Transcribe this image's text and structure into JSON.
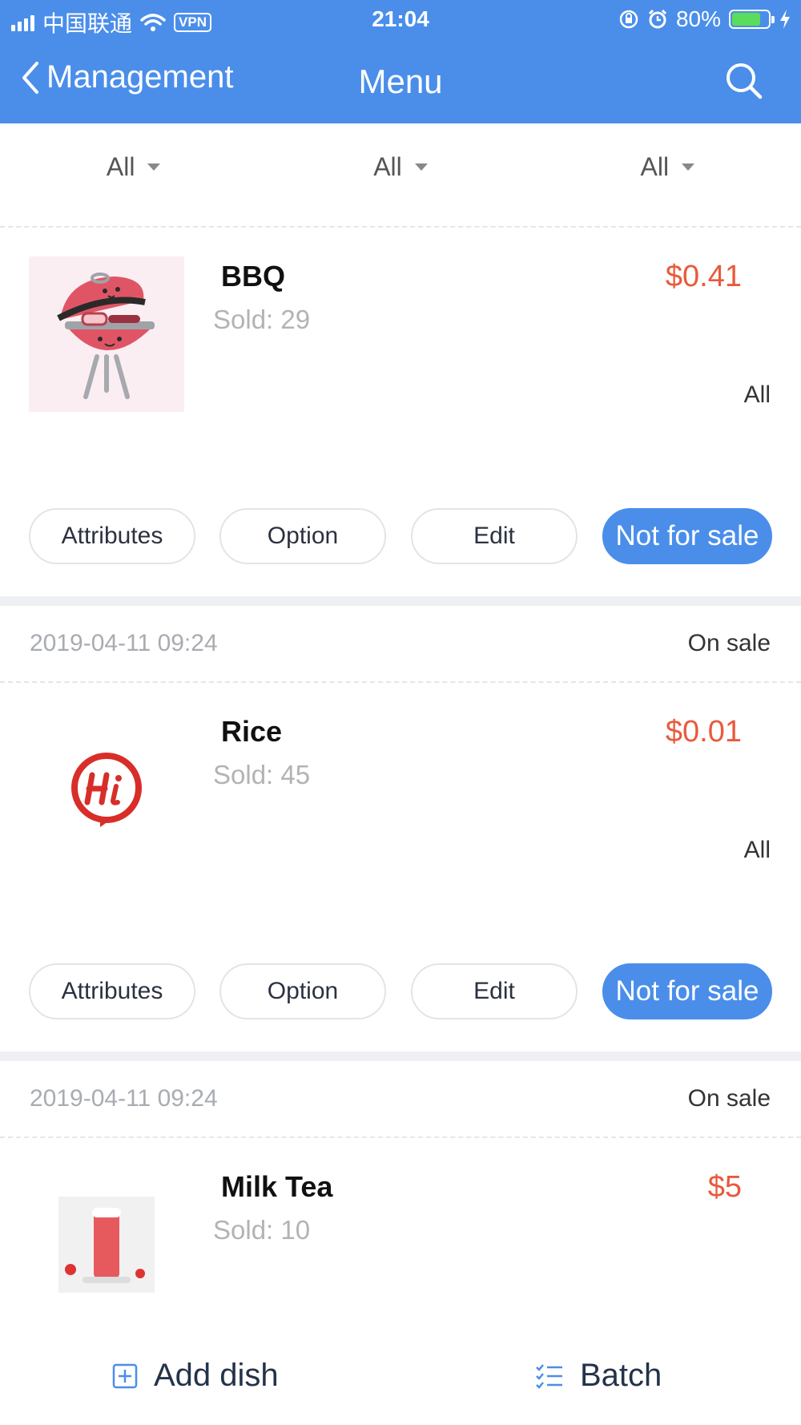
{
  "status_bar": {
    "carrier": "中国联通",
    "vpn": "VPN",
    "time": "21:04",
    "battery": "80%",
    "battery_level": 0.8
  },
  "nav": {
    "back_label": "Management",
    "title": "Menu"
  },
  "filters": [
    {
      "label": "All"
    },
    {
      "label": "All"
    },
    {
      "label": "All"
    }
  ],
  "dishes": [
    {
      "name": "BBQ",
      "sold": "Sold: 29",
      "price": "$0.41",
      "category": "All",
      "image_icon": "bbq-grill-image"
    },
    {
      "name": "Rice",
      "sold": "Sold: 45",
      "price": "$0.01",
      "category": "All",
      "image_icon": "hi-logo-image",
      "date": "2019-04-11 09:24",
      "status": "On sale"
    },
    {
      "name": "Milk Tea",
      "sold": "Sold: 10",
      "price": "$5",
      "image_icon": "milk-tea-image",
      "date": "2019-04-11 09:24",
      "status": "On sale"
    }
  ],
  "actions": {
    "attributes": "Attributes",
    "option": "Option",
    "edit": "Edit",
    "not_for_sale": "Not for sale"
  },
  "bottom": {
    "add_dish": "Add dish",
    "batch": "Batch"
  },
  "colors": {
    "header": "#4a8eea",
    "price": "#e85a3c",
    "primary_button": "#4a8eea"
  }
}
